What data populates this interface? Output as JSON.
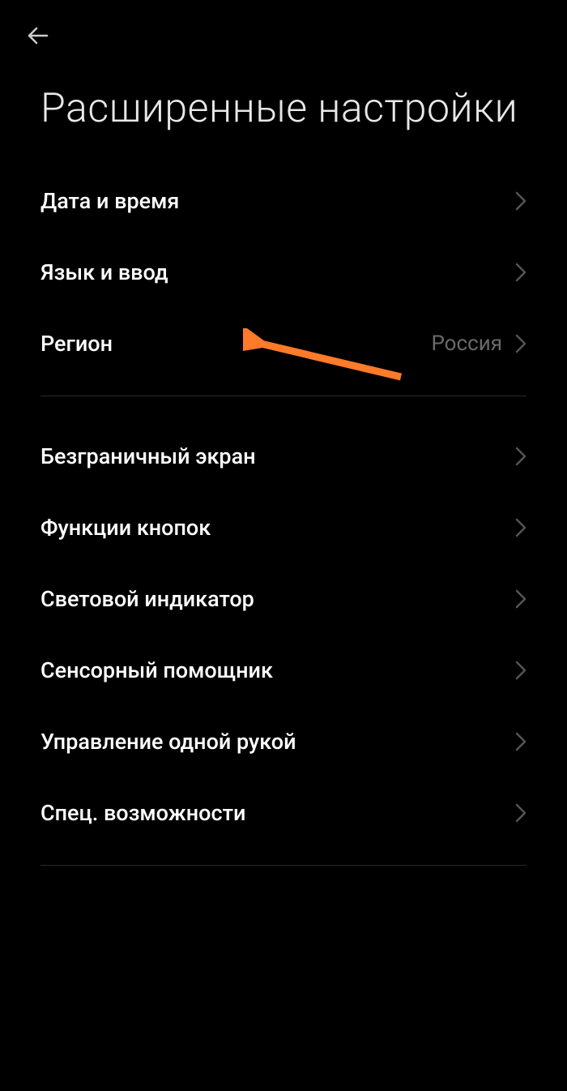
{
  "header": {
    "title": "Расширенные настройки"
  },
  "sections": [
    {
      "items": [
        {
          "label": "Дата и время",
          "value": ""
        },
        {
          "label": "Язык и ввод",
          "value": ""
        },
        {
          "label": "Регион",
          "value": "Россия"
        }
      ]
    },
    {
      "items": [
        {
          "label": "Безграничный экран",
          "value": ""
        },
        {
          "label": "Функции кнопок",
          "value": ""
        },
        {
          "label": "Световой индикатор",
          "value": ""
        },
        {
          "label": "Сенсорный помощник",
          "value": ""
        },
        {
          "label": "Управление одной рукой",
          "value": ""
        },
        {
          "label": "Спец. возможности",
          "value": ""
        }
      ]
    }
  ],
  "annotation": {
    "color": "#ff7a29"
  }
}
